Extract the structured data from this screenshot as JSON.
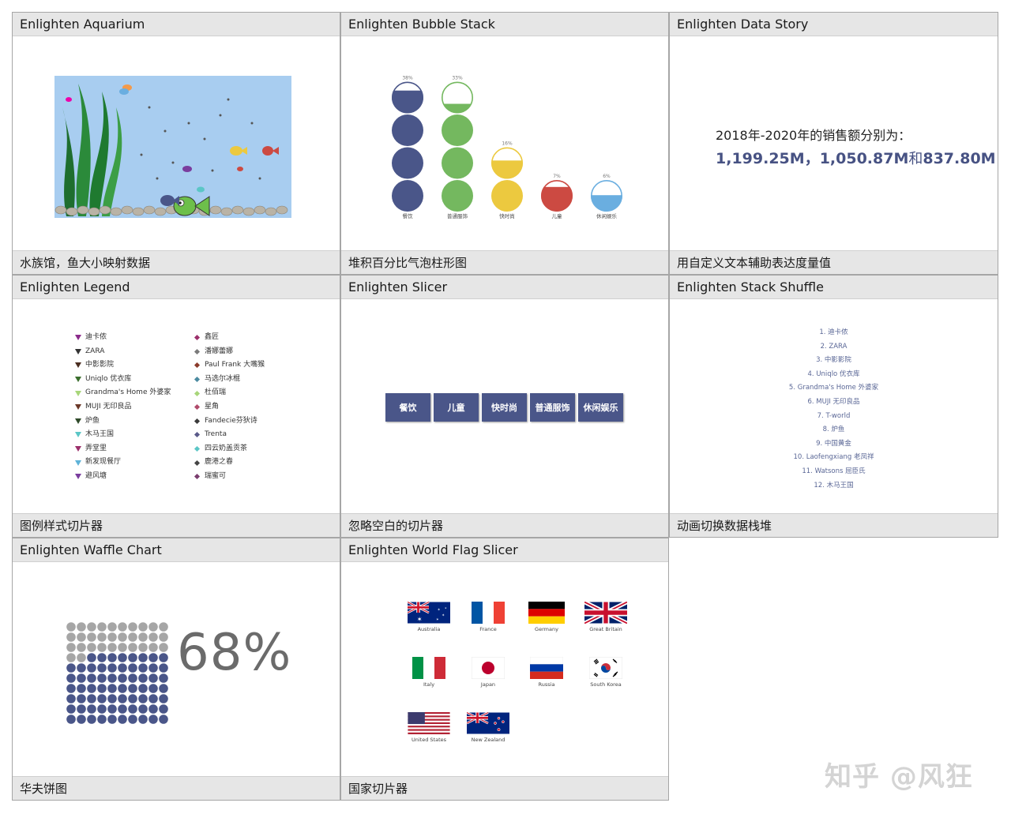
{
  "cards": {
    "aquarium": {
      "title": "Enlighten Aquarium",
      "caption": "水族馆，鱼大小映射数据"
    },
    "bubble": {
      "title": "Enlighten Bubble Stack",
      "caption": "堆积百分比气泡柱形图"
    },
    "story": {
      "title": "Enlighten Data Story",
      "caption": "用自定义文本辅助表达度量值"
    },
    "legend": {
      "title": "Enlighten Legend",
      "caption": "图例样式切片器"
    },
    "slicer": {
      "title": "Enlighten Slicer",
      "caption": "忽略空白的切片器"
    },
    "shuffle": {
      "title": "Enlighten Stack Shuffle",
      "caption": "动画切换数据栈堆"
    },
    "waffle": {
      "title": "Enlighten Waffle Chart",
      "caption": "华夫饼图"
    },
    "flags": {
      "title": "Enlighten World Flag Slicer",
      "caption": "国家切片器"
    }
  },
  "bubble_chart": {
    "categories": [
      "餐饮",
      "普通服饰",
      "快时尚",
      "儿童",
      "休闲娱乐"
    ],
    "percent_labels": [
      "38%",
      "33%",
      "16%",
      "7%",
      "6%"
    ],
    "circle_counts": [
      4,
      4,
      2,
      1,
      1
    ],
    "top_fill": [
      0.72,
      0.3,
      0.58,
      0.78,
      0.52
    ],
    "colors": [
      "#4a5689",
      "#74b85f",
      "#ecc93f",
      "#cc4a42",
      "#6aaee0"
    ]
  },
  "story": {
    "line1": "2018年-2020年的销售额分别为：",
    "v1": "1,199.25M",
    "sep": "，",
    "v2": "1,050.87M",
    "he": "和",
    "v3": "837.80M"
  },
  "legend": {
    "left": [
      {
        "label": "迪卡侬",
        "color": "#8b2b8b"
      },
      {
        "label": "ZARA",
        "color": "#333333"
      },
      {
        "label": "中影影院",
        "color": "#4a2d20"
      },
      {
        "label": "Uniqlo 优衣库",
        "color": "#3a6e2c"
      },
      {
        "label": "Grandma's Home 外婆家",
        "color": "#a8d67a"
      },
      {
        "label": "MUJI 无印良品",
        "color": "#6b3828"
      },
      {
        "label": "炉鱼",
        "color": "#2f4a2a"
      },
      {
        "label": "木马王国",
        "color": "#5bc6c6"
      },
      {
        "label": "弄堂里",
        "color": "#9b2f6b"
      },
      {
        "label": "新发现餐厅",
        "color": "#5fb3d8"
      },
      {
        "label": "避风塘",
        "color": "#7a3d9e"
      }
    ],
    "right": [
      {
        "label": "鑫匠",
        "color": "#9c2f6b"
      },
      {
        "label": "潘娜蕾娜",
        "color": "#7a7a7a"
      },
      {
        "label": "Paul Frank 大嘴猴",
        "color": "#8b3b2b"
      },
      {
        "label": "马选尔冰棍",
        "color": "#4b8aa0"
      },
      {
        "label": "杜佰瑞",
        "color": "#a8d67a"
      },
      {
        "label": "星角",
        "color": "#b04a6a"
      },
      {
        "label": "Fandecie芬狄诗",
        "color": "#3a3a3a"
      },
      {
        "label": "Trenta",
        "color": "#5a5a8a"
      },
      {
        "label": "四云奶盖贡茶",
        "color": "#5bc6c6"
      },
      {
        "label": "鹿港之春",
        "color": "#444444"
      },
      {
        "label": "瑞蜜可",
        "color": "#7a3d6e"
      }
    ]
  },
  "slicer": {
    "buttons": [
      "餐饮",
      "儿童",
      "快时尚",
      "普通服饰",
      "休闲娱乐"
    ]
  },
  "shuffle": {
    "items": [
      "1. 迪卡侬",
      "2. ZARA",
      "3. 中影影院",
      "4. Uniqlo 优衣库",
      "5. Grandma's Home 外婆家",
      "6. MUJI 无印良品",
      "7. T-world",
      "8. 炉鱼",
      "9. 中国黄金",
      "10. Laofengxiang 老凤祥",
      "11. Watsons 屈臣氏",
      "12. 木马王国"
    ]
  },
  "waffle": {
    "percent_label": "68%",
    "value": 0.68,
    "filled_color": "#4a5689",
    "empty_color": "#a6a6a6"
  },
  "flags": {
    "items": [
      "Australia",
      "France",
      "Germany",
      "Great Britain",
      "Italy",
      "Japan",
      "Russia",
      "South Korea",
      "United States",
      "New Zealand"
    ]
  },
  "watermark": "知乎 @风狂"
}
